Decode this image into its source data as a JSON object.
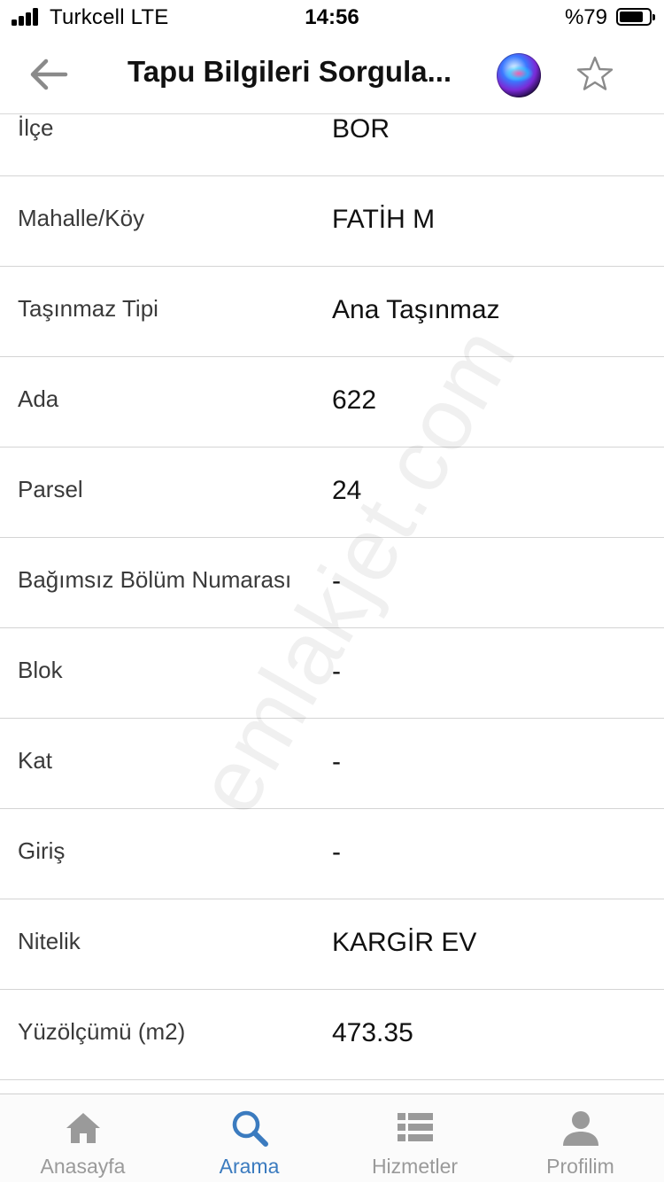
{
  "status_bar": {
    "carrier": "Turkcell  LTE",
    "time": "14:56",
    "battery": "%79"
  },
  "nav": {
    "title": "Tapu Bilgileri Sorgula...",
    "back_icon": "arrow-left-icon",
    "siri_icon": "siri-icon",
    "favorite_icon": "star-outline-icon"
  },
  "details": [
    {
      "label": "İlçe",
      "value": "BOR"
    },
    {
      "label": "Mahalle/Köy",
      "value": "FATİH M"
    },
    {
      "label": "Taşınmaz Tipi",
      "value": "Ana Taşınmaz"
    },
    {
      "label": "Ada",
      "value": "622"
    },
    {
      "label": "Parsel",
      "value": "24"
    },
    {
      "label": "Bağımsız Bölüm Numarası",
      "value": "-"
    },
    {
      "label": "Blok",
      "value": "-"
    },
    {
      "label": "Kat",
      "value": "-"
    },
    {
      "label": "Giriş",
      "value": "-"
    },
    {
      "label": "Nitelik",
      "value": "KARGİR EV"
    },
    {
      "label": "Yüzölçümü (m2)",
      "value": "473.35"
    }
  ],
  "watermark": "emlakjet.com",
  "tabs": [
    {
      "label": "Anasayfa",
      "icon": "home-icon"
    },
    {
      "label": "Arama",
      "icon": "search-icon",
      "active": true
    },
    {
      "label": "Hizmetler",
      "icon": "list-icon"
    },
    {
      "label": "Profilim",
      "icon": "person-icon"
    }
  ],
  "colors": {
    "active_tab": "#3b7bbf",
    "inactive_tab": "#9a9a9a",
    "divider": "#d4d4d4"
  }
}
